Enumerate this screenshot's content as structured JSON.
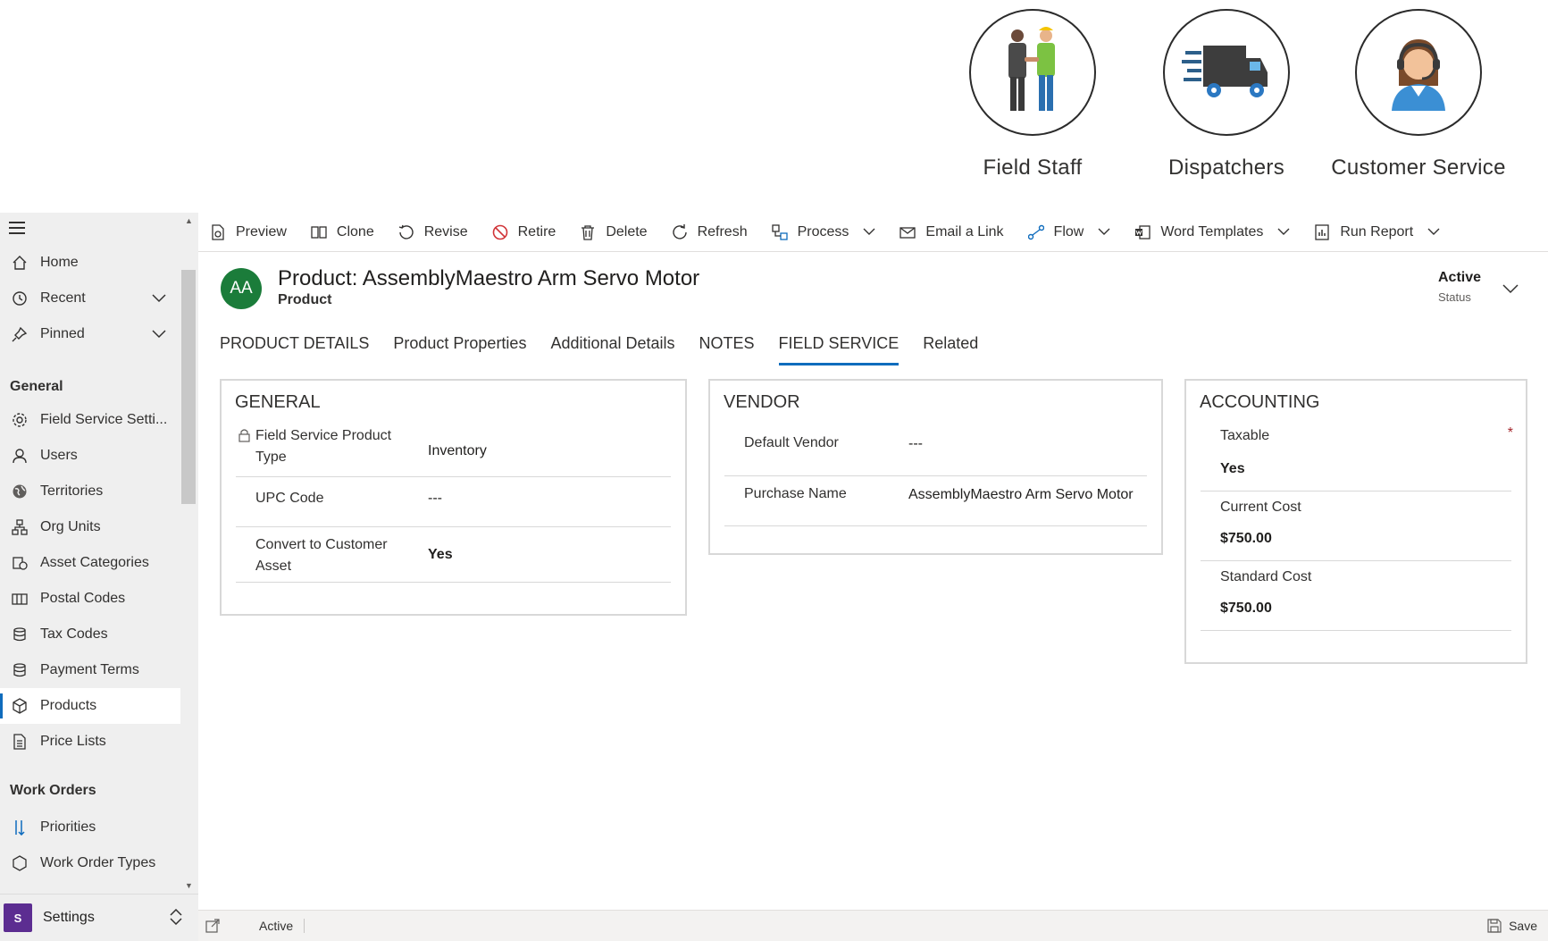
{
  "personas": [
    {
      "label": "Field Staff",
      "icon": "handshake-workers-icon"
    },
    {
      "label": "Dispatchers",
      "icon": "delivery-truck-icon"
    },
    {
      "label": "Customer Service",
      "icon": "headset-agent-icon"
    }
  ],
  "sidebar": {
    "top_items": [
      {
        "label": "Home",
        "icon": "home-icon"
      },
      {
        "label": "Recent",
        "icon": "clock-icon"
      },
      {
        "label": "Pinned",
        "icon": "pin-icon"
      }
    ],
    "general_heading": "General",
    "general_items": [
      {
        "label": "Field Service Setti...",
        "icon": "gear-icon"
      },
      {
        "label": "Users",
        "icon": "person-icon"
      },
      {
        "label": "Territories",
        "icon": "globe-icon"
      },
      {
        "label": "Org Units",
        "icon": "org-chart-icon"
      },
      {
        "label": "Asset Categories",
        "icon": "asset-icon"
      },
      {
        "label": "Postal Codes",
        "icon": "mailbox-icon"
      },
      {
        "label": "Tax Codes",
        "icon": "database-icon"
      },
      {
        "label": "Payment Terms",
        "icon": "database-icon"
      },
      {
        "label": "Products",
        "icon": "box-icon"
      },
      {
        "label": "Price Lists",
        "icon": "document-icon"
      }
    ],
    "active_item": "Products",
    "work_orders_heading": "Work Orders",
    "work_order_items": [
      {
        "label": "Priorities",
        "icon": "priority-icon"
      },
      {
        "label": "Work Order Types",
        "icon": "box-icon"
      }
    ],
    "settings": {
      "badge": "S",
      "label": "Settings"
    }
  },
  "commands": [
    {
      "label": "Preview",
      "icon": "preview-icon",
      "dropdown": false
    },
    {
      "label": "Clone",
      "icon": "clone-icon",
      "dropdown": false
    },
    {
      "label": "Revise",
      "icon": "revise-icon",
      "dropdown": false
    },
    {
      "label": "Retire",
      "icon": "retire-icon",
      "dropdown": false
    },
    {
      "label": "Delete",
      "icon": "trash-icon",
      "dropdown": false
    },
    {
      "label": "Refresh",
      "icon": "refresh-icon",
      "dropdown": false
    },
    {
      "label": "Process",
      "icon": "process-icon",
      "dropdown": true
    },
    {
      "label": "Email a Link",
      "icon": "email-icon",
      "dropdown": false
    },
    {
      "label": "Flow",
      "icon": "flow-icon",
      "dropdown": true
    },
    {
      "label": "Word Templates",
      "icon": "word-icon",
      "dropdown": true
    },
    {
      "label": "Run Report",
      "icon": "report-icon",
      "dropdown": true
    }
  ],
  "record": {
    "avatar_initials": "AA",
    "title": "Product: AssemblyMaestro Arm Servo Motor",
    "entity": "Product",
    "status_value": "Active",
    "status_label": "Status"
  },
  "tabs": [
    "PRODUCT DETAILS",
    "Product Properties",
    "Additional Details",
    "NOTES",
    "FIELD SERVICE",
    "Related"
  ],
  "active_tab": "FIELD SERVICE",
  "general": {
    "title": "GENERAL",
    "fields": [
      {
        "label": "Field Service Product Type",
        "value": "Inventory",
        "locked": true
      },
      {
        "label": "UPC Code",
        "value": "---"
      },
      {
        "label": "Convert to Customer Asset",
        "value": "Yes"
      }
    ]
  },
  "vendor": {
    "title": "VENDOR",
    "fields": [
      {
        "label": "Default Vendor",
        "value": "---"
      },
      {
        "label": "Purchase Name",
        "value": "AssemblyMaestro Arm Servo Motor"
      }
    ]
  },
  "accounting": {
    "title": "ACCOUNTING",
    "fields": [
      {
        "label": "Taxable",
        "value": "Yes",
        "required": "*"
      },
      {
        "label": "Current Cost",
        "value": "$750.00"
      },
      {
        "label": "Standard Cost",
        "value": "$750.00"
      }
    ]
  },
  "footer": {
    "status": "Active",
    "save_label": "Save"
  }
}
